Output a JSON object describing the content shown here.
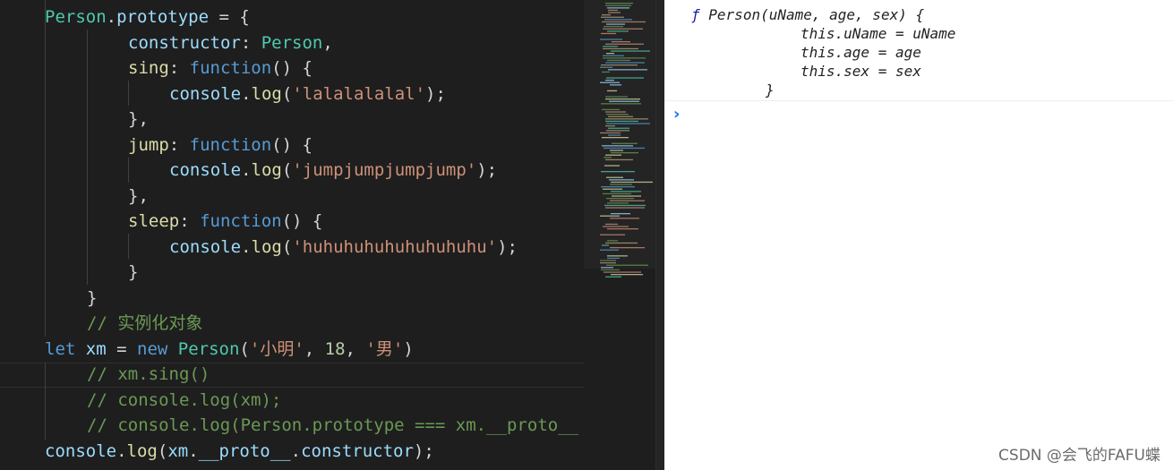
{
  "editor": {
    "lines": [
      {
        "parts": [
          {
            "t": "Person",
            "c": "cls"
          },
          {
            "t": ".",
            "c": "p"
          },
          {
            "t": "prototype",
            "c": "var"
          },
          {
            "t": " = {",
            "c": "p"
          }
        ]
      },
      {
        "parts": [
          {
            "t": "constructor",
            "c": "prop"
          },
          {
            "t": ": ",
            "c": "p"
          },
          {
            "t": "Person",
            "c": "cls"
          },
          {
            "t": ",",
            "c": "p"
          }
        ]
      },
      {
        "parts": [
          {
            "t": "sing",
            "c": "fn"
          },
          {
            "t": ": ",
            "c": "p"
          },
          {
            "t": "function",
            "c": "kw"
          },
          {
            "t": "() {",
            "c": "p"
          }
        ]
      },
      {
        "parts": [
          {
            "t": "console",
            "c": "var"
          },
          {
            "t": ".",
            "c": "p"
          },
          {
            "t": "log",
            "c": "fn"
          },
          {
            "t": "(",
            "c": "p"
          },
          {
            "t": "'lalalalalal'",
            "c": "str"
          },
          {
            "t": ");",
            "c": "p"
          }
        ]
      },
      {
        "parts": [
          {
            "t": "},",
            "c": "p"
          }
        ]
      },
      {
        "parts": [
          {
            "t": "jump",
            "c": "fn"
          },
          {
            "t": ": ",
            "c": "p"
          },
          {
            "t": "function",
            "c": "kw"
          },
          {
            "t": "() {",
            "c": "p"
          }
        ]
      },
      {
        "parts": [
          {
            "t": "console",
            "c": "var"
          },
          {
            "t": ".",
            "c": "p"
          },
          {
            "t": "log",
            "c": "fn"
          },
          {
            "t": "(",
            "c": "p"
          },
          {
            "t": "'jumpjumpjumpjump'",
            "c": "str"
          },
          {
            "t": ");",
            "c": "p"
          }
        ]
      },
      {
        "parts": [
          {
            "t": "},",
            "c": "p"
          }
        ]
      },
      {
        "parts": [
          {
            "t": "sleep",
            "c": "fn"
          },
          {
            "t": ": ",
            "c": "p"
          },
          {
            "t": "function",
            "c": "kw"
          },
          {
            "t": "() {",
            "c": "p"
          }
        ]
      },
      {
        "parts": [
          {
            "t": "console",
            "c": "var"
          },
          {
            "t": ".",
            "c": "p"
          },
          {
            "t": "log",
            "c": "fn"
          },
          {
            "t": "(",
            "c": "p"
          },
          {
            "t": "'huhuhuhuhuhuhuhuhu'",
            "c": "str"
          },
          {
            "t": ");",
            "c": "p"
          }
        ]
      },
      {
        "parts": [
          {
            "t": "}",
            "c": "p"
          }
        ]
      },
      {
        "parts": [
          {
            "t": "}",
            "c": "p"
          }
        ]
      },
      {
        "parts": [
          {
            "t": "// 实例化对象",
            "c": "cmt"
          }
        ]
      },
      {
        "parts": [
          {
            "t": "let",
            "c": "kw"
          },
          {
            "t": " ",
            "c": "p"
          },
          {
            "t": "xm",
            "c": "var"
          },
          {
            "t": " = ",
            "c": "p"
          },
          {
            "t": "new",
            "c": "kw"
          },
          {
            "t": " ",
            "c": "p"
          },
          {
            "t": "Person",
            "c": "cls"
          },
          {
            "t": "(",
            "c": "p"
          },
          {
            "t": "'小明'",
            "c": "str"
          },
          {
            "t": ", ",
            "c": "p"
          },
          {
            "t": "18",
            "c": "num"
          },
          {
            "t": ", ",
            "c": "p"
          },
          {
            "t": "'男'",
            "c": "str"
          },
          {
            "t": ")",
            "c": "p"
          }
        ]
      },
      {
        "parts": [
          {
            "t": "// xm.sing()",
            "c": "cmt"
          }
        ]
      },
      {
        "parts": [
          {
            "t": "// console.log(xm);",
            "c": "cmt"
          }
        ]
      },
      {
        "parts": [
          {
            "t": "// console.log(Person.prototype === xm.__proto__",
            "c": "cmt"
          }
        ]
      },
      {
        "parts": [
          {
            "t": "console",
            "c": "var"
          },
          {
            "t": ".",
            "c": "p"
          },
          {
            "t": "log",
            "c": "fn"
          },
          {
            "t": "(",
            "c": "p"
          },
          {
            "t": "xm",
            "c": "var"
          },
          {
            "t": ".",
            "c": "p"
          },
          {
            "t": "__proto__",
            "c": "var"
          },
          {
            "t": ".",
            "c": "p"
          },
          {
            "t": "constructor",
            "c": "var"
          },
          {
            "t": ");",
            "c": "p"
          }
        ]
      }
    ]
  },
  "console": {
    "output": {
      "f_symbol": "ƒ",
      "line1": "Person(uName, age, sex) {",
      "line2": "this.uName = uName",
      "line3": "this.age = age",
      "line4": "this.sex = sex",
      "line5": "}"
    },
    "prompt_icon": "chevron-right-icon",
    "prompt_glyph": "›"
  },
  "watermark": "CSDN @会飞的FAFU蝶",
  "colors": {
    "keyword": "#569cd6",
    "variable": "#9cdcfe",
    "class": "#4ec9b0",
    "function": "#dcdcaa",
    "string": "#ce9178",
    "number": "#b5cea8",
    "comment": "#6a9955",
    "console_prompt": "#1a73e8"
  }
}
